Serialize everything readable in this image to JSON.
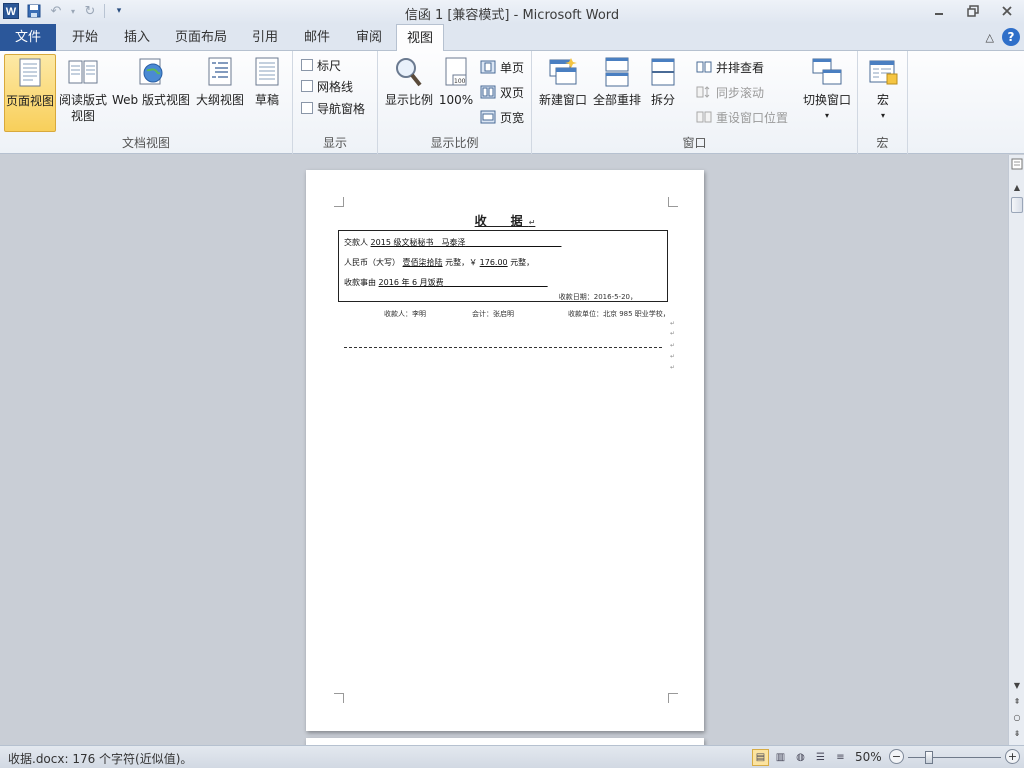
{
  "titlebar": {
    "title": "信函 1 [兼容模式] - Microsoft Word",
    "app_icon": "W"
  },
  "tabs": {
    "file": "文件",
    "items": [
      "开始",
      "插入",
      "页面布局",
      "引用",
      "邮件",
      "审阅",
      "视图"
    ],
    "active": "视图"
  },
  "ribbon": {
    "doc_views": {
      "label": "文档视图",
      "print_layout": "页面视图",
      "reading_line1": "阅读版式",
      "reading_line2": "视图",
      "web_layout": "Web 版式视图",
      "outline": "大纲视图",
      "draft": "草稿"
    },
    "show": {
      "label": "显示",
      "ruler": "标尺",
      "gridlines": "网格线",
      "nav_pane": "导航窗格"
    },
    "zoom": {
      "label": "显示比例",
      "zoom": "显示比例",
      "hundred": "100%",
      "one_page": "单页",
      "two_pages": "双页",
      "page_width": "页宽"
    },
    "window": {
      "label": "窗口",
      "new_window": "新建窗口",
      "arrange_all": "全部重排",
      "split": "拆分",
      "side_by_side": "并排查看",
      "sync_scroll": "同步滚动",
      "reset_position": "重设窗口位置",
      "switch_windows": "切换窗口"
    },
    "macros": {
      "label": "宏",
      "macros": "宏"
    }
  },
  "document": {
    "title": "收　据",
    "line1_label": "交款人",
    "line1_value": "2015 级文秘秘书　马泰泽",
    "line2_label": "人民币（大写）",
    "line2_value": "壹佰柒拾陆",
    "line2_mid": "元整，￥",
    "line2_amount": "176.00",
    "line2_end": "元整，",
    "line3_label": "收款事由",
    "line3_value": "2016 年 6 月饭费",
    "date": "收款日期：2016-5-20，",
    "payee": "收款人：李明",
    "accountant": "会计：张启明",
    "unit": "收款单位：北京 985 职业学校，"
  },
  "statusbar": {
    "text": "收据.docx: 176 个字符(近似值)。",
    "zoom": "50%",
    "zoom_fraction": 0.5
  }
}
